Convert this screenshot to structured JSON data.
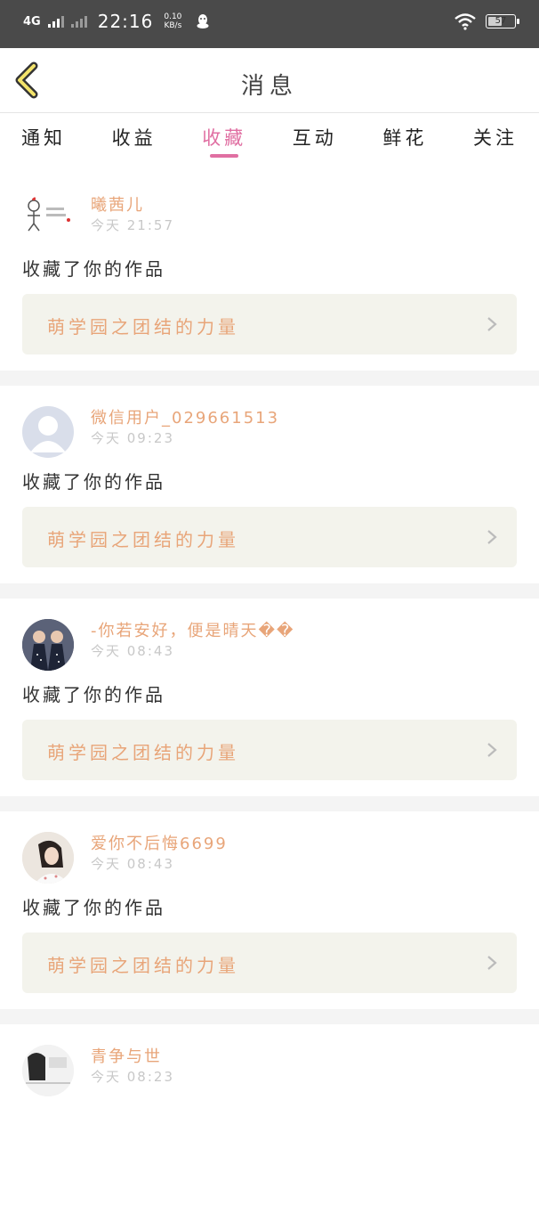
{
  "status_bar": {
    "network": "4G",
    "time": "22:16",
    "speed_value": "0.10",
    "speed_unit": "KB/s",
    "battery": "57",
    "battery_level": 0.57
  },
  "header": {
    "title": "消息",
    "back_icon": "chevron-left-icon"
  },
  "tabs": [
    {
      "label": "通知",
      "active": false
    },
    {
      "label": "收益",
      "active": false
    },
    {
      "label": "收藏",
      "active": true
    },
    {
      "label": "互动",
      "active": false
    },
    {
      "label": "鲜花",
      "active": false
    },
    {
      "label": "关注",
      "active": false
    }
  ],
  "accent_color": "#e06fa2",
  "name_color": "#e8a579",
  "messages": [
    {
      "name": "曦茜儿",
      "time": "今天 21:57",
      "action": "收藏了你的作品",
      "work": "萌学园之团结的力量"
    },
    {
      "name": "微信用户_029661513",
      "time": "今天 09:23",
      "action": "收藏了你的作品",
      "work": "萌学园之团结的力量"
    },
    {
      "name": "-你若安好，便是晴天��",
      "time": "今天 08:43",
      "action": "收藏了你的作品",
      "work": "萌学园之团结的力量"
    },
    {
      "name": "爱你不后悔6699",
      "time": "今天 08:43",
      "action": "收藏了你的作品",
      "work": "萌学园之团结的力量"
    },
    {
      "name": "青争与世",
      "time": "今天 08:23",
      "action": "",
      "work": ""
    }
  ]
}
